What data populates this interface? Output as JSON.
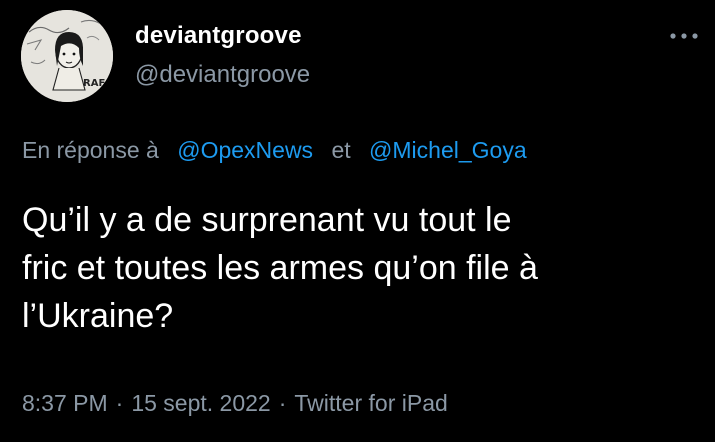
{
  "author": {
    "display_name": "deviantgroove",
    "handle": "@deviantgroove",
    "avatar_icon": "profile-avatar-sketch",
    "avatar_text": "RAF"
  },
  "more_icon": "ellipsis-icon",
  "reply": {
    "prefix": "En réponse à",
    "mention_1": "@OpexNews",
    "conjunction": "et",
    "mention_2": "@Michel_Goya"
  },
  "tweet": {
    "lines": [
      "Qu’il y a de surprenant vu tout le",
      "fric et toutes les armes qu’on file à",
      "l’Ukraine?"
    ]
  },
  "meta": {
    "time": "8:37 PM",
    "date": "15 sept. 2022",
    "source": "Twitter for iPad",
    "separator": "·"
  },
  "colors": {
    "background": "#000000",
    "text": "#ffffff",
    "secondary": "#8b98a5",
    "link": "#1d9bf0"
  }
}
